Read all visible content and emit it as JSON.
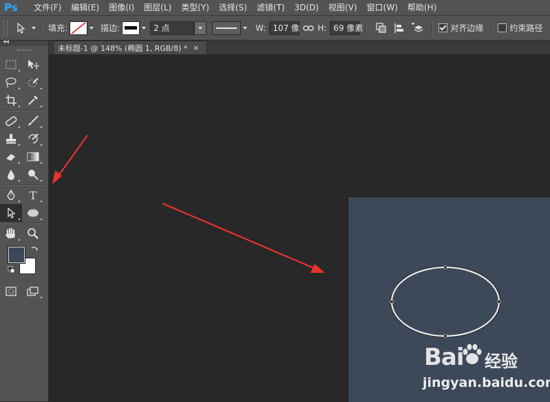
{
  "app": {
    "logo": "Ps",
    "menu": [
      "文件(F)",
      "编辑(E)",
      "图像(I)",
      "图层(L)",
      "类型(Y)",
      "选择(S)",
      "滤镜(T)",
      "3D(D)",
      "视图(V)",
      "窗口(W)",
      "帮助(H)"
    ]
  },
  "options": {
    "fill_label": "填充:",
    "stroke_label": "描边:",
    "stroke_width": "2 点",
    "w_label": "W:",
    "w_value": "107 像",
    "h_label": "H:",
    "h_value": "69 像素",
    "align_edges_label": "对齐边缘",
    "align_edges_checked": true,
    "constrain_path_label": "约束路径",
    "constrain_path_checked": false
  },
  "document": {
    "tab_title": "未标题-1 @ 148% (椭圆 1, RGB/8) *",
    "close_glyph": "×"
  },
  "colors": {
    "foreground": "#3c4858",
    "background": "#ffffff",
    "canvas": "#3d4858",
    "workspace": "#282828",
    "annotation_arrow": "#e8322f"
  },
  "watermark": {
    "logo": "Bai",
    "logo_suffix": "经验",
    "url": "jingyan.baidu.com"
  }
}
